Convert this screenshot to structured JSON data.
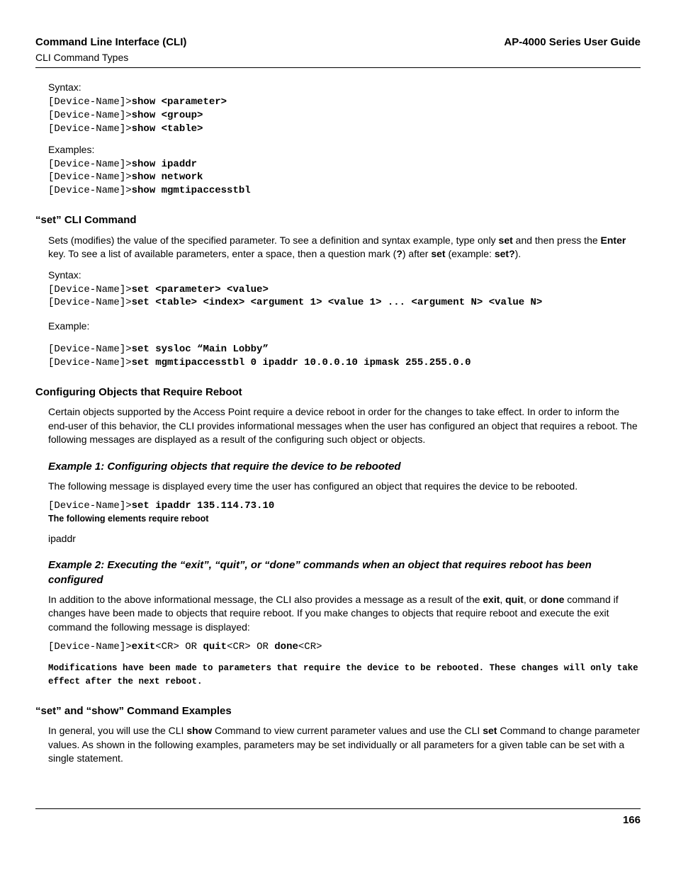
{
  "header": {
    "left_title": "Command Line Interface (CLI)",
    "left_sub": "CLI Command Types",
    "right": "AP-4000 Series User Guide"
  },
  "syntax1_label": "Syntax:",
  "syntax1_l1_pre": "[Device-Name]>",
  "syntax1_l1_cmd": "show <parameter>",
  "syntax1_l2_pre": "[Device-Name]>",
  "syntax1_l2_cmd": "show <group>",
  "syntax1_l3_pre": "[Device-Name]>",
  "syntax1_l3_cmd": "show <table>",
  "examples1_label": "Examples:",
  "ex1_l1_pre": "[Device-Name]>",
  "ex1_l1_cmd": "show ipaddr",
  "ex1_l2_pre": "[Device-Name]>",
  "ex1_l2_cmd": "show network",
  "ex1_l3_pre": "[Device-Name]>",
  "ex1_l3_cmd": "show mgmtipaccesstbl",
  "set_heading": "“set” CLI Command",
  "set_para_1": "Sets (modifies) the value of the specified parameter. To see a definition and syntax example, type only ",
  "set_para_set": "set",
  "set_para_2": " and then press the ",
  "set_para_enter": "Enter",
  "set_para_3": " key. To see a list of available parameters, enter a space, then a question mark (",
  "set_para_q": "?",
  "set_para_4": ") after ",
  "set_para_set2": "set",
  "set_para_5": " (example: ",
  "set_para_setq": "set?",
  "set_para_6": ").",
  "syntax2_label": "Syntax:",
  "syntax2_l1_pre": "[Device-Name]>",
  "syntax2_l1_cmd": "set <parameter> <value>",
  "syntax2_l2_pre": "[Device-Name]>",
  "syntax2_l2_cmd": "set <table> <index> <argument 1> <value 1> ... <argument N> <value N>",
  "example2_label": "Example:",
  "ex2_l1_pre": "[Device-Name]>",
  "ex2_l1_cmd": "set sysloc “Main Lobby”",
  "ex2_l2_pre": "[Device-Name]>",
  "ex2_l2_cmd": "set mgmtipaccesstbl 0 ipaddr 10.0.0.10 ipmask 255.255.0.0",
  "reboot_heading": "Configuring Objects that Require Reboot",
  "reboot_para": "Certain objects supported by the Access Point require a device reboot in order for the changes to take effect. In order to inform the end-user of this behavior, the CLI provides informational messages when the user has configured an object that requires a reboot. The following messages are displayed as a result of the configuring such object or objects.",
  "ex1_heading": "Example 1: Configuring objects that require the device to be rebooted",
  "ex1_para": "The following message is displayed every time the user has configured an object that requires the device to be rebooted.",
  "ex1_code_pre": "[Device-Name]>",
  "ex1_code_cmd": "set ipaddr 135.114.73.10",
  "ex1_msg": "The following elements require reboot",
  "ex1_ipaddr": "ipaddr",
  "ex2_heading": "Example 2: Executing the “exit”, “quit”, or “done” commands when an object that requires reboot has been configured",
  "ex2_para_1": "In addition to the above informational message, the CLI also provides a message as a result of the ",
  "ex2_exit": "exit",
  "ex2_comma1": ", ",
  "ex2_quit": "quit",
  "ex2_comma2": ", or ",
  "ex2_done": "done",
  "ex2_para_2": " command if changes have been made to objects that require reboot. If you make changes to objects that require reboot and execute the exit command the following message is displayed:",
  "ex2_code_pre": "[Device-Name]>",
  "ex2_code_exit": "exit",
  "ex2_code_cr1": "<CR> OR ",
  "ex2_code_quit": "quit",
  "ex2_code_cr2": "<CR> OR ",
  "ex2_code_done": "done",
  "ex2_code_cr3": "<CR>",
  "ex2_msg": "Modifications have been made to parameters that require the device to be rebooted. These changes will only take effect after the next reboot.",
  "setshow_heading": "“set” and “show” Command Examples",
  "setshow_para_1": "In general, you will use the CLI ",
  "setshow_show": "show",
  "setshow_para_2": " Command to view current parameter values and use the CLI ",
  "setshow_set": "set",
  "setshow_para_3": " Command to change parameter values. As shown in the following examples, parameters may be set individually or all parameters for a given table can be set with a single statement.",
  "page_number": "166"
}
